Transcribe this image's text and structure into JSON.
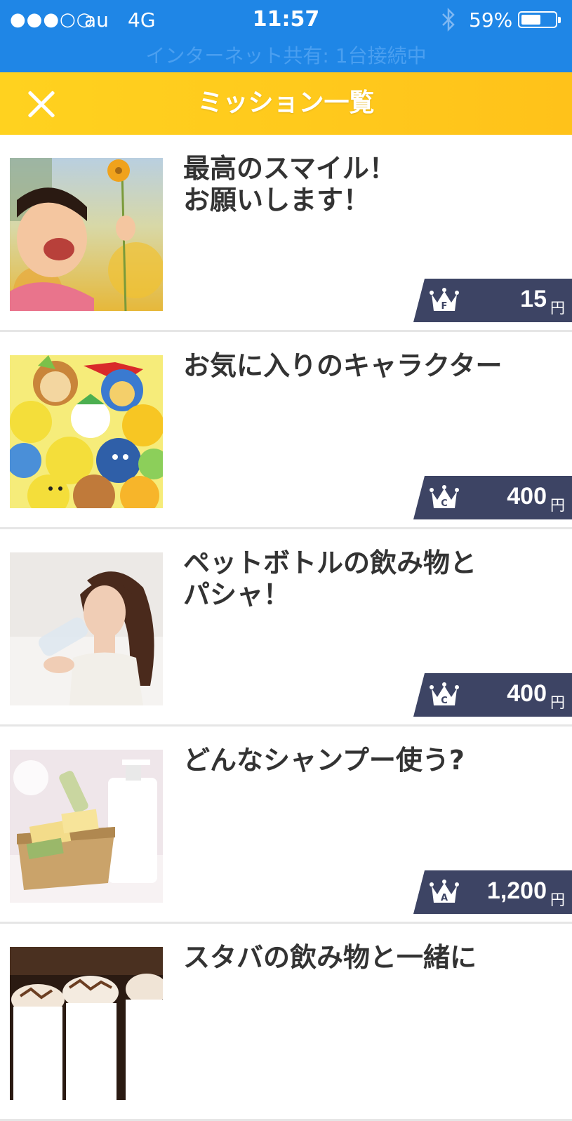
{
  "status": {
    "signal": "●●●○○",
    "carrier": "au",
    "network": "4G",
    "time": "11:57",
    "battery_pct": "59%",
    "battery_level": 0.59,
    "tethering": "インターネット共有: 1台接続中"
  },
  "header": {
    "title": "ミッション一覧",
    "close_icon": "close-icon"
  },
  "colors": {
    "status_bar": "#1f86e6",
    "header": "#ffc81c",
    "reward_badge": "#3d4464"
  },
  "missions": [
    {
      "title": "最高のスマイル！\nお願いします！",
      "rank": "F",
      "reward": "15",
      "unit": "円",
      "image": "smiling-girl-flowers-image"
    },
    {
      "title": "お気に入りのキャラクター",
      "rank": "C",
      "reward": "400",
      "unit": "円",
      "image": "character-plush-toys-image"
    },
    {
      "title": "ペットボトルの飲み物と\nパシャ！",
      "rank": "C",
      "reward": "400",
      "unit": "円",
      "image": "woman-drinking-water-image"
    },
    {
      "title": "どんなシャンプー使う?",
      "rank": "A",
      "reward": "1,200",
      "unit": "円",
      "image": "shampoo-soap-basket-image"
    },
    {
      "title": "スタバの飲み物と一緒に",
      "rank": "",
      "reward": "",
      "unit": "",
      "image": "frappuccino-drinks-image"
    }
  ]
}
